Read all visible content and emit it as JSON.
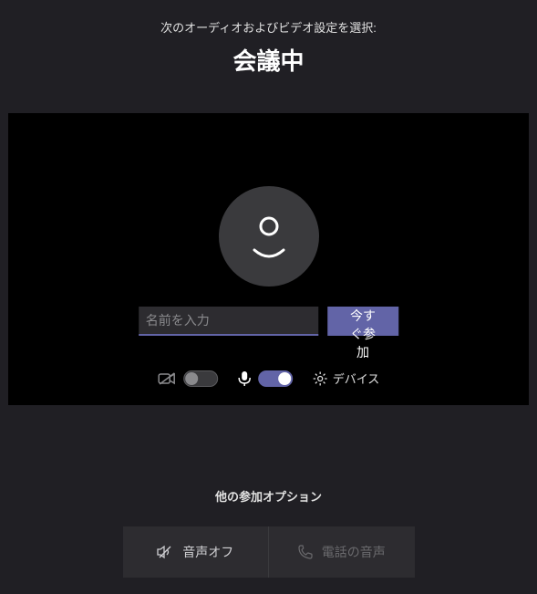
{
  "header": {
    "subtitle": "次のオーディオおよびビデオ設定を選択:",
    "title": "会議中"
  },
  "join": {
    "name_placeholder": "名前を入力",
    "name_value": "",
    "button_label": "今すぐ参加"
  },
  "controls": {
    "camera_on": false,
    "mic_on": true,
    "device_label": "デバイス"
  },
  "other": {
    "title": "他の参加オプション",
    "audio_off_label": "音声オフ",
    "phone_audio_label": "電話の音声"
  },
  "icons": {
    "avatar": "person-icon",
    "camera_off": "camera-off-icon",
    "mic": "mic-icon",
    "gear": "gear-icon",
    "speaker_off": "speaker-off-icon",
    "phone": "phone-icon"
  }
}
